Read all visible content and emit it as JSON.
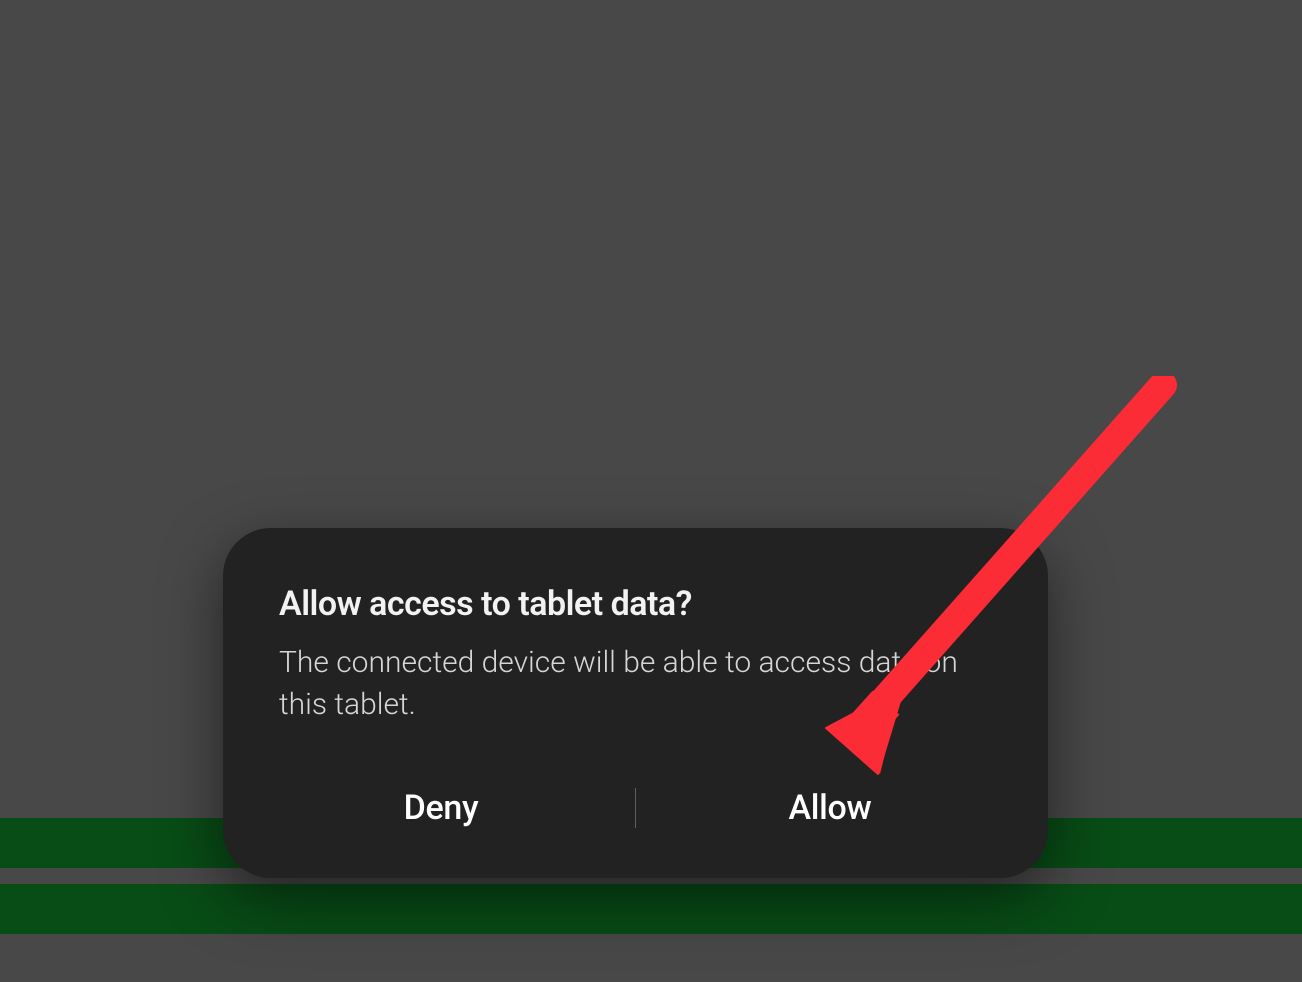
{
  "dialog": {
    "title": "Allow access to tablet data?",
    "body": "The connected device will be able to access data on this tablet.",
    "deny_label": "Deny",
    "allow_label": "Allow"
  },
  "annotation": {
    "arrow_color": "#fb2c36"
  }
}
